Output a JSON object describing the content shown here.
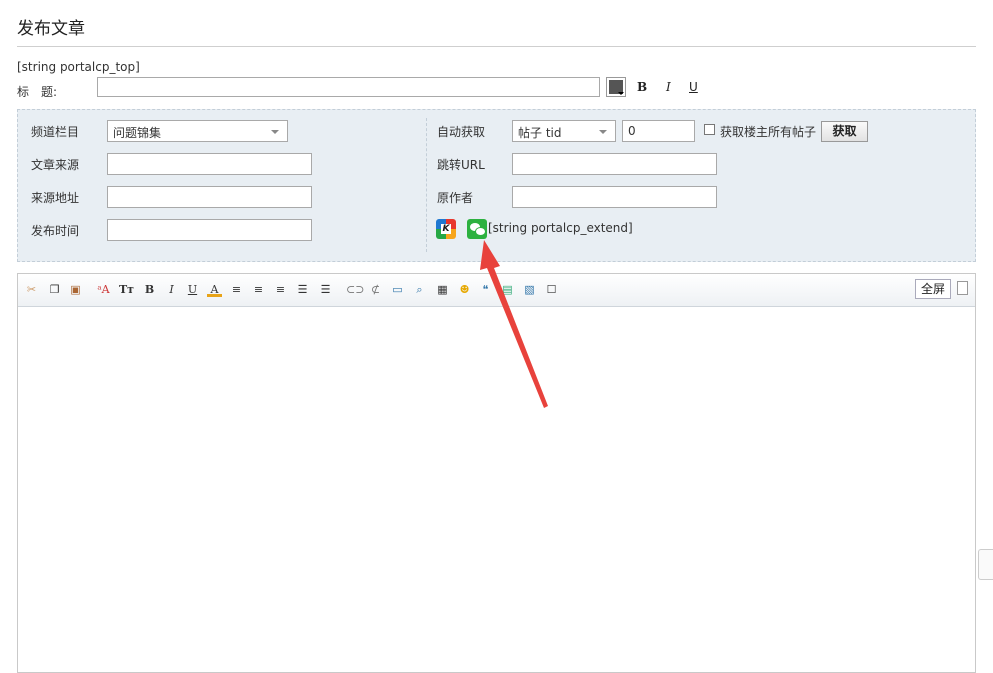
{
  "header": {
    "title": "发布文章"
  },
  "hooks": {
    "top": "[string portalcp_top]",
    "extend": "[string portalcp_extend]"
  },
  "title_row": {
    "label": "标　题:",
    "value": "",
    "bold": "B",
    "italic": "I",
    "underline": "U"
  },
  "form": {
    "channel_label": "频道栏目",
    "channel_value": "问题锦集",
    "source_label": "文章来源",
    "source_url_label": "来源地址",
    "publish_time_label": "发布时间",
    "auto_fetch_label": "自动获取",
    "auto_fetch_type": "帖子 tid",
    "auto_fetch_value": "0",
    "fetch_all_label": "获取楼主所有帖子",
    "fetch_button": "获取",
    "redirect_label": "跳转URL",
    "author_label": "原作者"
  },
  "icons": {
    "k_icon_letter": "K",
    "toolbar": [
      "cut-icon",
      "copy-icon",
      "paste-icon",
      "font-icon",
      "font-size-icon",
      "bold-icon",
      "italic-icon",
      "underline-icon",
      "font-color-icon",
      "align-left-icon",
      "align-center-icon",
      "align-right-icon",
      "ordered-list-icon",
      "unordered-list-icon",
      "link-icon",
      "unlink-icon",
      "image-icon",
      "attachment-icon",
      "video-icon",
      "emoticon-icon",
      "quote-icon",
      "code-icon",
      "page-break-icon",
      "checkbox-icon"
    ]
  },
  "toolbar_labels": {
    "font": "ᵃA",
    "font_size": "Tт",
    "bold": "B",
    "italic": "I",
    "underline": "U",
    "font_color": "A"
  },
  "editor": {
    "fullscreen": "全屏",
    "content": ""
  },
  "colors": {
    "panel_bg": "#e8eef3",
    "arrow": "#e8423c",
    "wechat": "#2db140"
  }
}
